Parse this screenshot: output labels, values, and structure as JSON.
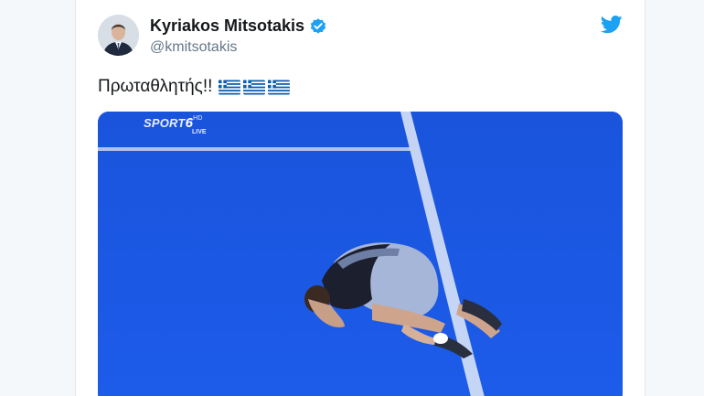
{
  "tweet": {
    "author": {
      "display_name": "Kyriakos Mitsotakis",
      "handle": "@kmitsotakis",
      "verified": true,
      "avatar_icon": "profile-photo"
    },
    "text": "Πρωταθλητής!!",
    "emoji": [
      "greek-flag",
      "greek-flag",
      "greek-flag"
    ],
    "platform_icon": "twitter-bird-icon"
  },
  "media": {
    "channel_logo": "SPORT",
    "channel_number": "6",
    "channel_hd": "HD",
    "channel_live": "LIVE"
  },
  "colors": {
    "twitter_blue": "#1da1f2",
    "court_blue": "#1b58e3",
    "text_primary": "#14171a",
    "text_secondary": "#657786"
  }
}
